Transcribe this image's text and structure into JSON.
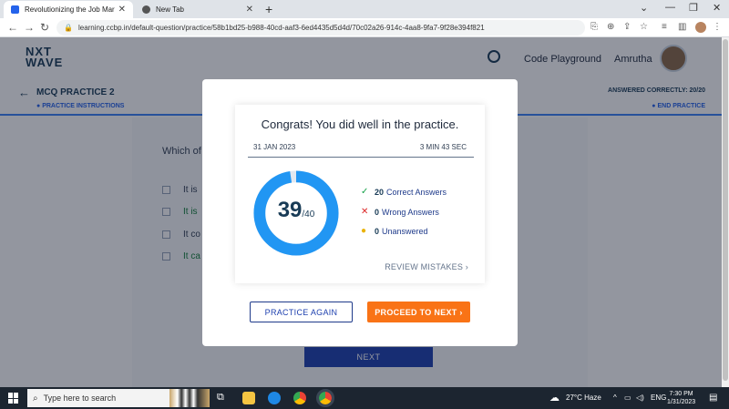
{
  "browser": {
    "tabs": [
      {
        "title": "Revolutionizing the Job Market |"
      },
      {
        "title": "New Tab"
      }
    ],
    "url": "learning.ccbp.in/default-question/practice/58b1bd25-b988-40cd-aaf3-6ed4435d5d4d/70c02a26-914c-4aa8-9fa7-9f28e394f821"
  },
  "header": {
    "logo_line1": "NXT",
    "logo_line2": "WAVE",
    "code_playground": "Code Playground",
    "username": "Amrutha"
  },
  "subbar": {
    "title": "MCQ PRACTICE 2",
    "instructions": "PRACTICE INSTRUCTIONS",
    "answered": "ANSWERED CORRECTLY: 20/20",
    "end_practice": "END PRACTICE"
  },
  "question": {
    "text": "Which of",
    "options": [
      "It is",
      "It is",
      "It co",
      "It ca"
    ],
    "next_label": "NEXT"
  },
  "modal": {
    "congrats": "Congrats! You did well in the practice.",
    "date": "31 JAN 2023",
    "time": "3 MIN 43 SEC",
    "score": "39",
    "total": "/40",
    "score_fraction": 0.975,
    "stats": [
      {
        "count": "20",
        "label": "Correct Answers",
        "icon": "check-icon",
        "color": "#16a34a"
      },
      {
        "count": "0",
        "label": "Wrong Answers",
        "icon": "cross-icon",
        "color": "#dc2626"
      },
      {
        "count": "0",
        "label": "Unanswered",
        "icon": "dot-icon",
        "color": "#eab308"
      }
    ],
    "review": "REVIEW MISTAKES",
    "practice_again": "PRACTICE AGAIN",
    "proceed": "PROCEED TO NEXT",
    "accent": "#2196f3"
  },
  "taskbar": {
    "search_placeholder": "Type here to search",
    "weather": "27°C  Haze",
    "lang": "ENG",
    "time": "7:30 PM",
    "date": "1/31/2023"
  }
}
